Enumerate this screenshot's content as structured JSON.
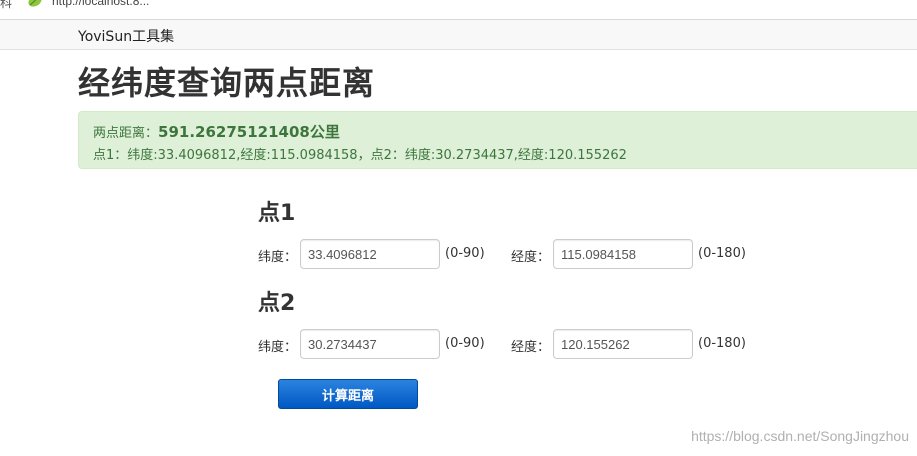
{
  "browser": {
    "clipped_text": "科",
    "url": "http://localhost:8..."
  },
  "navbar": {
    "brand": "YoviSun工具集"
  },
  "page": {
    "title": "经纬度查询两点距离"
  },
  "result": {
    "distance_label": "两点距离：",
    "distance_value": "591.26275121408公里",
    "detail": "点1：纬度:33.4096812,经度:115.0984158，点2：纬度:30.2734437,经度:120.155262"
  },
  "form": {
    "point1": {
      "heading": "点1",
      "lat_label": "纬度：",
      "lat_value": "33.4096812",
      "lat_range": "(0-90)",
      "lng_label": "经度：",
      "lng_value": "115.0984158",
      "lng_range": "(0-180)"
    },
    "point2": {
      "heading": "点2",
      "lat_label": "纬度：",
      "lat_value": "30.2734437",
      "lat_range": "(0-90)",
      "lng_label": "经度：",
      "lng_value": "120.155262",
      "lng_range": "(0-180)"
    },
    "submit_label": "计算距离"
  },
  "watermark": "https://blog.csdn.net/SongJingzhou",
  "icons": {
    "favicon": "leaf-icon"
  },
  "colors": {
    "alert_bg": "#dff0d8",
    "alert_text": "#3c763d",
    "button_blue": "#0058c4"
  }
}
